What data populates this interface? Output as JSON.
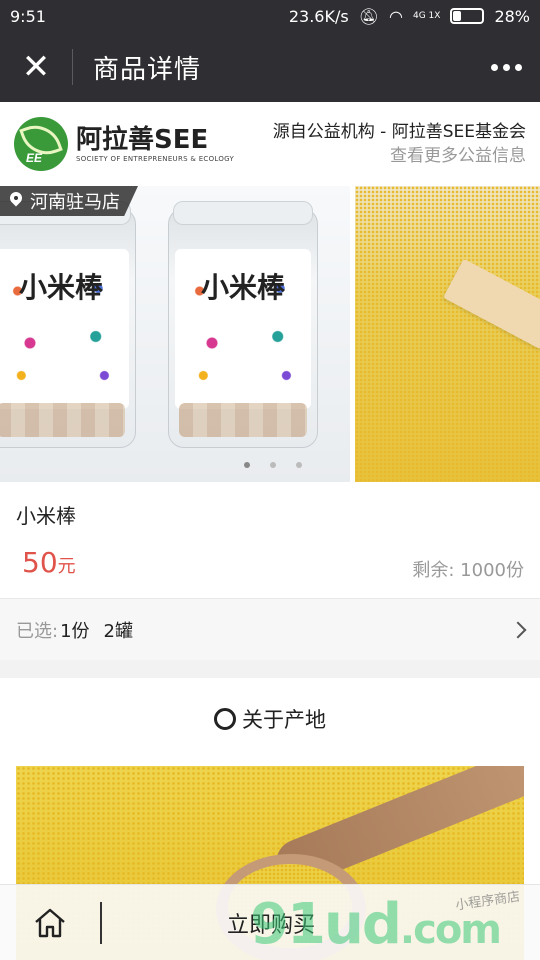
{
  "status": {
    "time": "9:51",
    "network": "23.6K/s",
    "signal_small": "4G 1X",
    "battery": "28%",
    "battery_fraction": 0.28
  },
  "nav": {
    "title": "商品详情"
  },
  "brand": {
    "logo_initials": "EE",
    "logo_main": "阿拉善SEE",
    "logo_sub": "SOCIETY OF ENTREPRENEURS & ECOLOGY",
    "source_line": "源自公益机构 - 阿拉善SEE基金会",
    "more_link": "查看更多公益信息"
  },
  "gallery": {
    "location_tag": "河南驻马店",
    "jar_title": "小米棒",
    "slide_count": 3,
    "active_index": 0
  },
  "product": {
    "name": "小米棒",
    "price_value": "50",
    "price_unit": "元",
    "stock": "剩余: 1000份"
  },
  "selection": {
    "label": "已选:",
    "qty": "1份",
    "spec": "2罐"
  },
  "section": {
    "title": "关于产地"
  },
  "bottom": {
    "buy_label": "立即购买"
  },
  "watermark": {
    "big": "91ud",
    "com": ".com",
    "small": "小程序商店"
  },
  "colors": {
    "price": "#e0534a",
    "navbar": "#2e2e33",
    "logo_green": "#3a9a3a"
  }
}
